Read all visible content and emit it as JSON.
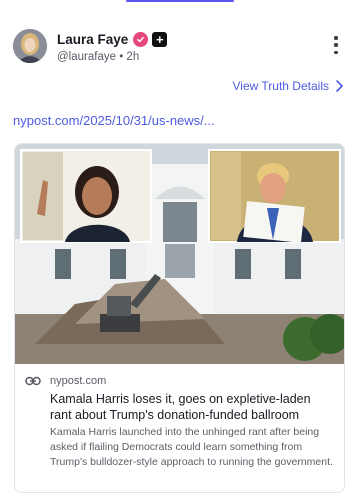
{
  "post": {
    "author_name": "Laura Faye",
    "handle": "@laurafaye",
    "separator": "•",
    "time": "2h",
    "view_details": "View Truth Details",
    "link_text": "nypost.com/2025/10/31/us-news/..."
  },
  "card": {
    "source": "nypost.com",
    "title": "Kamala Harris loses it, goes on expletive-laden rant about Trump's donation-funded ballroom",
    "description": "Kamala Harris launched into the unhinged rant after being asked if flailing Democrats could learn something from Trump's bulldozer-style approach to running the government."
  },
  "icons": {
    "verified": "verified-check-icon",
    "plus": "plus-badge-icon",
    "more": "more-vertical-icon",
    "chevron": "chevron-right-icon",
    "link": "link-icon"
  },
  "colors": {
    "accent": "#4f5be0",
    "verified": "#e5487a",
    "text": "#1a1a24",
    "muted": "#5a5a66"
  }
}
